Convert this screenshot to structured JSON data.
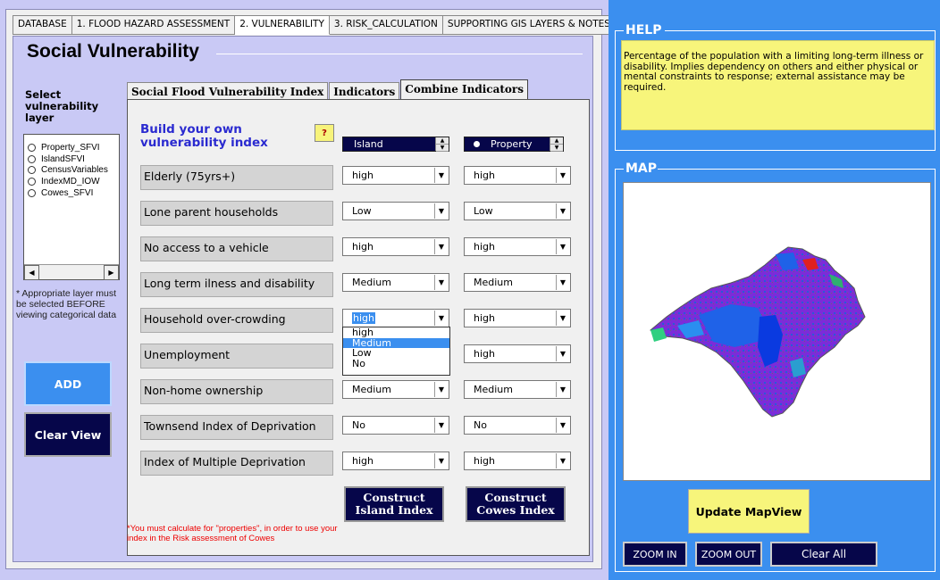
{
  "tabs": [
    {
      "label": "DATABASE"
    },
    {
      "label": "1. FLOOD HAZARD ASSESSMENT"
    },
    {
      "label": "2. VULNERABILITY"
    },
    {
      "label": "3. RISK_CALCULATION"
    },
    {
      "label": "SUPPORTING GIS LAYERS & NOTES"
    }
  ],
  "social": {
    "title": "Social Vulnerability",
    "select_label": "Select vulnerability layer",
    "layers": [
      "Property_SFVI",
      "IslandSFVI",
      "CensusVariables",
      "IndexMD_IOW",
      "Cowes_SFVI"
    ],
    "note": "* Appropriate layer must be selected BEFORE viewing categorical data",
    "add_label": "ADD",
    "clear_view_label": "Clear View"
  },
  "inner_tabs": [
    {
      "label": "Social Flood Vulnerability Index"
    },
    {
      "label": "Indicators"
    },
    {
      "label": "Combine Indicators"
    }
  ],
  "build": {
    "title": "Build your own vulnerability index",
    "help_label": "?",
    "spin_left": "Island",
    "spin_right": "Property",
    "indicators": [
      {
        "label": "Elderly (75yrs+)",
        "left": "high",
        "right": "high"
      },
      {
        "label": "Lone parent households",
        "left": "Low",
        "right": "Low"
      },
      {
        "label": "No access to a vehicle",
        "left": "high",
        "right": "high"
      },
      {
        "label": "Long term ilness and disability",
        "left": "Medium",
        "right": "Medium"
      },
      {
        "label": "Household over-crowding",
        "left": "high",
        "right": "high"
      },
      {
        "label": "Unemployment",
        "left": "",
        "right": "high"
      },
      {
        "label": "Non-home ownership",
        "left": "Medium",
        "right": "Medium"
      },
      {
        "label": "Townsend Index of Deprivation",
        "left": "No",
        "right": "No"
      },
      {
        "label": "Index of Multiple Deprivation",
        "left": "high",
        "right": "high"
      }
    ],
    "dropdown_options": [
      "high",
      "Medium",
      "Low",
      "No"
    ],
    "construct_island": "Construct Island Index",
    "construct_cowes": "Construct Cowes Index",
    "warning": "*You must calculate for \"properties\", in order to use your index in the Risk assessment of Cowes"
  },
  "help": {
    "heading": "HELP",
    "text": "Percentage of the population with a limiting long-term illness or disability. Implies dependency on others and either physical or mental constraints to response; external assistance may be required."
  },
  "map": {
    "heading": "MAP",
    "update_label": "Update MapView",
    "zoom_in": "ZOOM IN",
    "zoom_out": "ZOOM OUT",
    "clear_all": "Clear All"
  },
  "colors": {
    "navy": "#06064a",
    "accent_blue": "#3b8fef",
    "help_yellow": "#f7f57b",
    "panel_lilac": "#c9c9f5"
  }
}
